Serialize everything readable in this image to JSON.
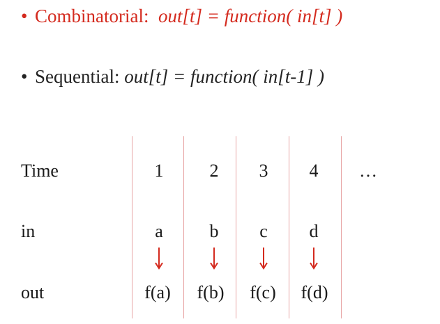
{
  "bullets": {
    "combinatorial": {
      "bullet": "•",
      "label": "Combinatorial:",
      "formula": "out[t] = function( in[t] )",
      "color": "#d42a1e"
    },
    "sequential": {
      "bullet": "•",
      "label": "Sequential:",
      "formula": "out[t] = function( in[t-1] )",
      "color": "#222222"
    }
  },
  "table": {
    "rows": {
      "time": "Time",
      "in": "in",
      "out": "out"
    },
    "columns": [
      {
        "time": "1",
        "in": "a",
        "out": "f(a)"
      },
      {
        "time": "2",
        "in": "b",
        "out": "f(b)"
      },
      {
        "time": "3",
        "in": "c",
        "out": "f(c)"
      },
      {
        "time": "4",
        "in": "d",
        "out": "f(d)"
      }
    ],
    "ellipsis": "…",
    "arrow_color": "#d42a1e",
    "divider_color": "#e7a4a4"
  }
}
